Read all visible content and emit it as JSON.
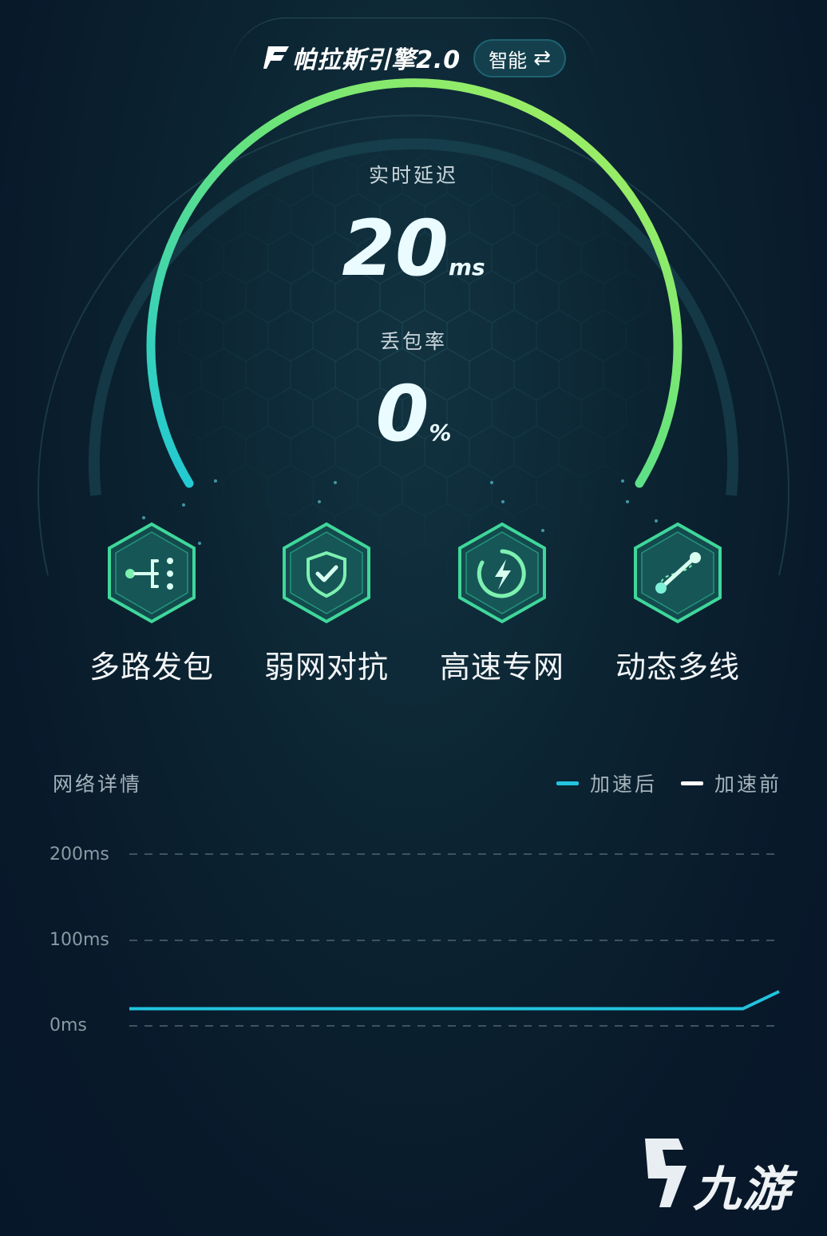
{
  "header": {
    "engine_title": "帕拉斯引擎2.0",
    "mode_label": "智能",
    "mode_icon": "swap-icon"
  },
  "gauge": {
    "latency_label": "实时延迟",
    "latency_value": "20",
    "latency_unit": "ms",
    "loss_label": "丢包率",
    "loss_value": "0",
    "loss_unit": "%",
    "accent_start": "#22c9d6",
    "accent_end": "#a6f25a"
  },
  "features": [
    {
      "label": "多路发包",
      "icon": "multi-path-icon"
    },
    {
      "label": "弱网对抗",
      "icon": "shield-check-icon"
    },
    {
      "label": "高速专网",
      "icon": "lightning-icon"
    },
    {
      "label": "动态多线",
      "icon": "dynamic-route-icon"
    }
  ],
  "network": {
    "title": "网络详情",
    "legend_after": "加速后",
    "legend_before": "加速前",
    "color_after": "#22c4e0",
    "color_before": "#ffffff"
  },
  "chart_data": {
    "type": "line",
    "y_ticks": [
      "200ms",
      "100ms",
      "0ms"
    ],
    "ylim": [
      0,
      200
    ],
    "series": [
      {
        "name": "加速后",
        "values": [
          20,
          20,
          20,
          20,
          20,
          20,
          20,
          20,
          20,
          20,
          20,
          20,
          20,
          20,
          20,
          20,
          20,
          20,
          40
        ]
      },
      {
        "name": "加速前",
        "values": []
      }
    ]
  },
  "watermark": {
    "text": "九游"
  }
}
